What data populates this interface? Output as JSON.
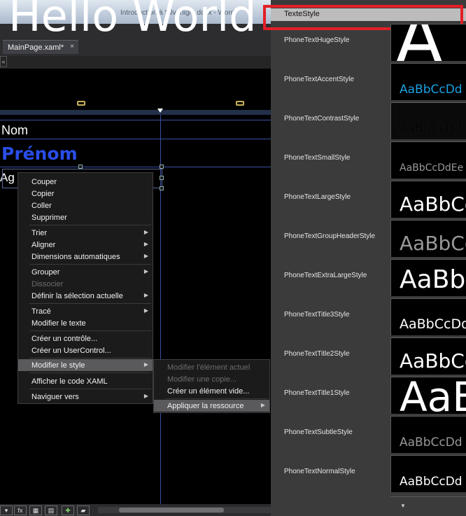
{
  "window": {
    "title": "Introduction à Silverlight.docx - Word"
  },
  "document_tab": {
    "label": "MainPage.xaml*",
    "close_glyph": "×"
  },
  "breadcrumb": {
    "glyph": "«"
  },
  "canvas": {
    "headline": "Hello World",
    "labels": {
      "nom": "Nom",
      "prenom": "Prénom",
      "age": "Ag"
    }
  },
  "context_menu": {
    "items": [
      {
        "label": "Couper",
        "enabled": true,
        "submenu": false
      },
      {
        "label": "Copier",
        "enabled": true,
        "submenu": false
      },
      {
        "label": "Coller",
        "enabled": true,
        "submenu": false
      },
      {
        "label": "Supprimer",
        "enabled": true,
        "submenu": false
      },
      {
        "label": "Trier",
        "enabled": true,
        "submenu": true
      },
      {
        "label": "Aligner",
        "enabled": true,
        "submenu": true
      },
      {
        "label": "Dimensions automatiques",
        "enabled": true,
        "submenu": true
      },
      {
        "label": "Grouper",
        "enabled": true,
        "submenu": true
      },
      {
        "label": "Dissocier",
        "enabled": false,
        "submenu": false
      },
      {
        "label": "Définir la sélection actuelle",
        "enabled": true,
        "submenu": true
      },
      {
        "label": "Tracé",
        "enabled": true,
        "submenu": true
      },
      {
        "label": "Modifier le texte",
        "enabled": true,
        "submenu": false
      },
      {
        "label": "Créer un contrôle...",
        "enabled": true,
        "submenu": false
      },
      {
        "label": "Créer un UserControl...",
        "enabled": true,
        "submenu": false
      },
      {
        "label": "Modifier le style",
        "enabled": true,
        "submenu": true,
        "highlighted": true
      },
      {
        "label": "Afficher le code XAML",
        "enabled": true,
        "submenu": false
      },
      {
        "label": "Naviguer vers",
        "enabled": true,
        "submenu": true
      }
    ],
    "submenu_arrow": "▶"
  },
  "style_submenu": {
    "items": [
      {
        "label": "Modifier l'élément actuel",
        "enabled": false
      },
      {
        "label": "Modifier une copie...",
        "enabled": false
      },
      {
        "label": "Créer un élément vide...",
        "enabled": true
      },
      {
        "label": "Appliquer la ressource",
        "enabled": true,
        "highlighted": true,
        "submenu": true
      }
    ]
  },
  "resource_panel": {
    "header": "TexteStyle",
    "styles": [
      {
        "name": "PhoneTextHugeStyle",
        "preview": "A",
        "color": "#ffffff"
      },
      {
        "name": "PhoneTextAccentStyle",
        "preview": "AaBbCcDd",
        "color": "#1ba1e2"
      },
      {
        "name": "PhoneTextContrastStyle",
        "preview": "AaBbCcDd",
        "color": "#000000"
      },
      {
        "name": "PhoneTextSmallStyle",
        "preview": "AaBbCcDdEe",
        "color": "#999999"
      },
      {
        "name": "PhoneTextLargeStyle",
        "preview": "AaBbCc",
        "color": "#ffffff"
      },
      {
        "name": "PhoneTextGroupHeaderStyle",
        "preview": "AaBbCc",
        "color": "#999999"
      },
      {
        "name": "PhoneTextExtraLargeStyle",
        "preview": "AaBb",
        "color": "#ffffff"
      },
      {
        "name": "PhoneTextTitle3Style",
        "preview": "AaBbCcDd",
        "color": "#ffffff"
      },
      {
        "name": "PhoneTextTitle2Style",
        "preview": "AaBbCc",
        "color": "#ffffff"
      },
      {
        "name": "PhoneTextTitle1Style",
        "preview": "AaB",
        "color": "#ffffff"
      },
      {
        "name": "PhoneTextSubtleStyle",
        "preview": "AaBbCcDd",
        "color": "#999999"
      },
      {
        "name": "PhoneTextNormalStyle",
        "preview": "AaBbCcDd",
        "color": "#ffffff"
      }
    ],
    "footer_glyph": "▼"
  },
  "statusbar": {
    "buttons": [
      {
        "name": "dropdown-icon",
        "glyph": "▾"
      },
      {
        "name": "effects-fx-icon",
        "glyph": "fx"
      },
      {
        "name": "grid-view-icon",
        "glyph": "▦"
      },
      {
        "name": "snap-grid-icon",
        "glyph": "▤"
      },
      {
        "name": "snap-lines-icon",
        "glyph": "✚"
      },
      {
        "name": "annotation-icon",
        "glyph": "▰"
      },
      {
        "name": "scroll-left-icon",
        "glyph": "◂"
      }
    ]
  },
  "accent_colors": {
    "selection_highlight": "#5a5a5d",
    "callout_border": "#e41f26",
    "blue_text": "#2a4de8"
  }
}
